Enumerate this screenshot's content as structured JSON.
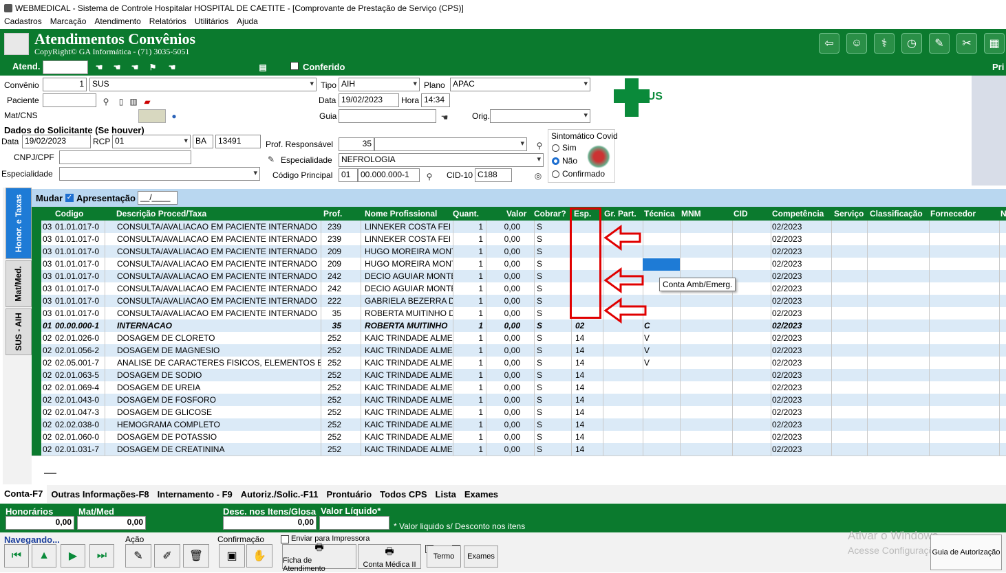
{
  "window": {
    "title": "WEBMEDICAL - Sistema de Controle Hospitalar HOSPITAL DE CAETITE - [Comprovante de Prestação de Serviço  (CPS)]"
  },
  "menu": [
    "Cadastros",
    "Marcação",
    "Atendimento",
    "Relatórios",
    "Utilitários",
    "Ajuda"
  ],
  "banner": {
    "title": "Atendimentos Convênios",
    "copyright": "CopyRight© GA Informática - (71) 3035-5051",
    "right_label": "Pri"
  },
  "atend": {
    "label": "Atend.",
    "value": "",
    "conferido": "Conferido"
  },
  "form": {
    "convenio_label": "Convênio",
    "convenio_code": "1",
    "convenio_name": "SUS",
    "tipo_label": "Tipo",
    "tipo": "AIH",
    "plano_label": "Plano",
    "plano": "APAC",
    "paciente_label": "Paciente",
    "paciente": "",
    "data_label": "Data",
    "data": "19/02/2023",
    "hora_label": "Hora",
    "hora": "14:34",
    "matcns_label": "Mat/CNS",
    "guia_label": "Guia",
    "guia": "",
    "orig_label": "Orig.",
    "orig": "",
    "solicitante_title": "Dados do Solicitante (Se houver)",
    "sol_data_label": "Data",
    "sol_data": "19/02/2023",
    "rcp_label": "RCP",
    "rcp": "01",
    "uf": "BA",
    "crm": "13491",
    "cnpj_label": "CNPJ/CPF",
    "cnpj": "",
    "especialidade_label": "Especialidade",
    "especialidade": "",
    "prof_resp_label": "Prof. Responsável",
    "prof_resp": "35",
    "esp2_label": "Especialidade",
    "esp2": "NEFROLOGIA",
    "codprinc_label": "Código Principal",
    "codprinc_a": "01",
    "codprinc_b": "00.000.000-1",
    "cid_label": "CID-10",
    "cid": "C188",
    "covid_title": "Sintomático Covid",
    "covid_sim": "Sim",
    "covid_nao": "Não",
    "covid_conf": "Confirmado"
  },
  "sus_logo": "SUS",
  "left_tabs": [
    "Honor. e Taxas",
    "Mat/Med.",
    "SUS - AIH"
  ],
  "mudar": {
    "label": "Mudar",
    "apresentacao_label": "Apresentação",
    "apresentacao": "__/____"
  },
  "grid": {
    "headers": [
      "Codigo",
      "Descrição Proced/Taxa",
      "Prof.",
      "Nome Profissional",
      "Quant.",
      "Valor",
      "Cobrar?",
      "Esp.",
      "Gr. Part.",
      "Técnica",
      "MNM",
      "CID",
      "Competência",
      "Serviço",
      "Classificação",
      "Fornecedor",
      "N"
    ],
    "rows": [
      [
        "03",
        "01.01.017-0",
        "CONSULTA/AVALIACAO EM PACIENTE INTERNADO",
        "239",
        "LINNEKER COSTA FEI",
        "1",
        "0,00",
        "S",
        "",
        "",
        "",
        "02/2023"
      ],
      [
        "03",
        "01.01.017-0",
        "CONSULTA/AVALIACAO EM PACIENTE INTERNADO",
        "239",
        "LINNEKER COSTA FEI",
        "1",
        "0,00",
        "S",
        "",
        "",
        "",
        "02/2023"
      ],
      [
        "03",
        "01.01.017-0",
        "CONSULTA/AVALIACAO EM PACIENTE INTERNADO",
        "209",
        "HUGO MOREIRA MONT",
        "1",
        "0,00",
        "S",
        "",
        "",
        "",
        "02/2023"
      ],
      [
        "03",
        "01.01.017-0",
        "CONSULTA/AVALIACAO EM PACIENTE INTERNADO",
        "209",
        "HUGO MOREIRA MONT",
        "1",
        "0,00",
        "S",
        "",
        "",
        "",
        "02/2023"
      ],
      [
        "03",
        "01.01.017-0",
        "CONSULTA/AVALIACAO EM PACIENTE INTERNADO",
        "242",
        "DECIO AGUIAR MONTE",
        "1",
        "0,00",
        "S",
        "",
        "",
        "",
        "02/2023"
      ],
      [
        "03",
        "01.01.017-0",
        "CONSULTA/AVALIACAO EM PACIENTE INTERNADO",
        "242",
        "DECIO AGUIAR MONTE",
        "1",
        "0,00",
        "S",
        "",
        "",
        "",
        "02/2023"
      ],
      [
        "03",
        "01.01.017-0",
        "CONSULTA/AVALIACAO EM PACIENTE INTERNADO",
        "222",
        "GABRIELA BEZERRA D",
        "1",
        "0,00",
        "S",
        "",
        "",
        "",
        "02/2023"
      ],
      [
        "03",
        "01.01.017-0",
        "CONSULTA/AVALIACAO EM PACIENTE INTERNADO",
        "35",
        "ROBERTA MUITINHO D",
        "1",
        "0,00",
        "S",
        "",
        "",
        "",
        "02/2023"
      ],
      [
        "01",
        "00.00.000-1",
        "INTERNACAO",
        "35",
        "ROBERTA MUITINHO",
        "1",
        "0,00",
        "S",
        "02",
        "",
        "C",
        "02/2023"
      ],
      [
        "02",
        "02.01.026-0",
        "DOSAGEM DE CLORETO",
        "252",
        "KAIC TRINDADE ALME",
        "1",
        "0,00",
        "S",
        "14",
        "",
        "V",
        "02/2023"
      ],
      [
        "02",
        "02.01.056-2",
        "DOSAGEM DE MAGNESIO",
        "252",
        "KAIC TRINDADE ALME",
        "1",
        "0,00",
        "S",
        "14",
        "",
        "V",
        "02/2023"
      ],
      [
        "02",
        "02.05.001-7",
        "ANALISE DE CARACTERES FISICOS, ELEMENTOS E",
        "252",
        "KAIC TRINDADE ALME",
        "1",
        "0,00",
        "S",
        "14",
        "",
        "V",
        "02/2023"
      ],
      [
        "02",
        "02.01.063-5",
        "DOSAGEM DE SODIO",
        "252",
        "KAIC TRINDADE ALME",
        "1",
        "0,00",
        "S",
        "14",
        "",
        "",
        "02/2023"
      ],
      [
        "02",
        "02.01.069-4",
        "DOSAGEM DE UREIA",
        "252",
        "KAIC TRINDADE ALME",
        "1",
        "0,00",
        "S",
        "14",
        "",
        "",
        "02/2023"
      ],
      [
        "02",
        "02.01.043-0",
        "DOSAGEM DE FOSFORO",
        "252",
        "KAIC TRINDADE ALME",
        "1",
        "0,00",
        "S",
        "14",
        "",
        "",
        "02/2023"
      ],
      [
        "02",
        "02.01.047-3",
        "DOSAGEM DE GLICOSE",
        "252",
        "KAIC TRINDADE ALME",
        "1",
        "0,00",
        "S",
        "14",
        "",
        "",
        "02/2023"
      ],
      [
        "02",
        "02.02.038-0",
        "HEMOGRAMA COMPLETO",
        "252",
        "KAIC TRINDADE ALME",
        "1",
        "0,00",
        "S",
        "14",
        "",
        "",
        "02/2023"
      ],
      [
        "02",
        "02.01.060-0",
        "DOSAGEM DE POTASSIO",
        "252",
        "KAIC TRINDADE ALME",
        "1",
        "0,00",
        "S",
        "14",
        "",
        "",
        "02/2023"
      ],
      [
        "02",
        "02.01.031-7",
        "DOSAGEM DE CREATININA",
        "252",
        "KAIC TRINDADE ALME",
        "1",
        "0,00",
        "S",
        "14",
        "",
        "",
        "02/2023"
      ]
    ],
    "bold_row": 8
  },
  "tooltip": "Conta Amb/Emerg.",
  "bottom_tabs": [
    "Conta-F7",
    "Outras Informações-F8",
    "Internamento - F9",
    "Autoriz./Solic.-F11",
    "Prontuário",
    "Todos CPS",
    "Lista",
    "Exames"
  ],
  "totals": {
    "honorarios_label": "Honorários",
    "honorarios": "0,00",
    "matmed_label": "Mat/Med",
    "matmed": "0,00",
    "desc_label": "Desc. nos Itens/Glosa",
    "desc": "0,00",
    "liquido_label": "Valor Líquido*",
    "liquido": "",
    "note": "* Valor liquido s/ Desconto nos itens"
  },
  "nav": {
    "navegando": "Navegando...",
    "acao": "Ação",
    "confirmacao": "Confirmação",
    "enviar": "Enviar para Impressora",
    "ficha": "Ficha de Atendimento",
    "conta_medica": "Conta Médica II",
    "termo": "Termo",
    "exames": "Exames",
    "guia": "Guia de Autorização"
  },
  "watermark": {
    "l1": "Ativar o Windows",
    "l2": "Acesse Configurações"
  }
}
